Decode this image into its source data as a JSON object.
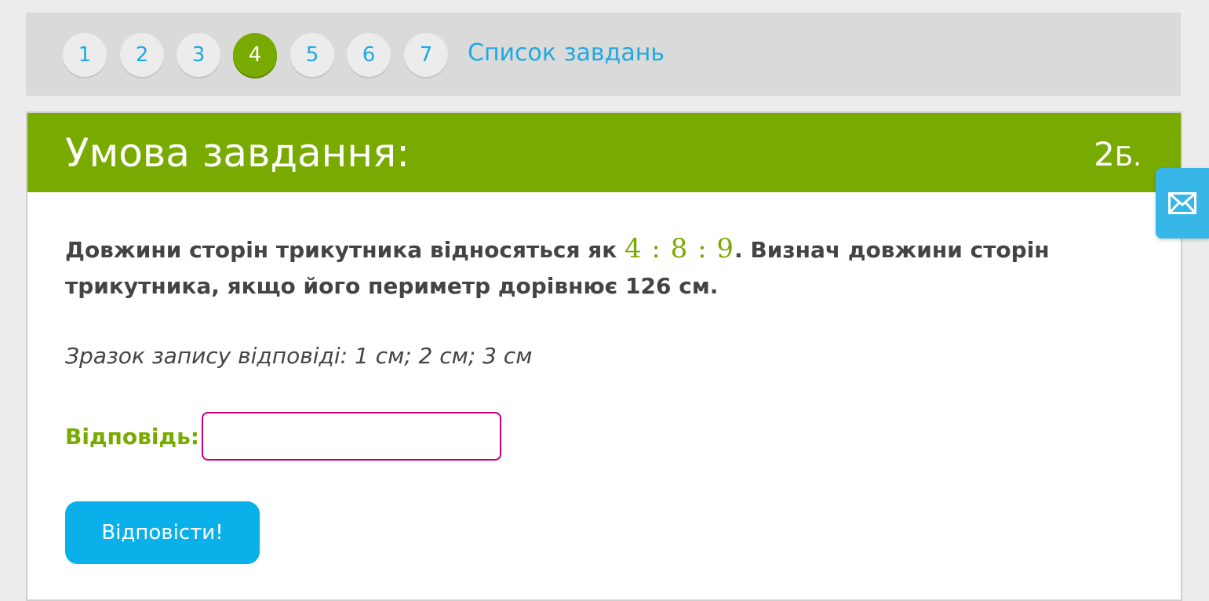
{
  "nav": {
    "tasks": [
      {
        "label": "1",
        "active": false
      },
      {
        "label": "2",
        "active": false
      },
      {
        "label": "3",
        "active": false
      },
      {
        "label": "4",
        "active": true
      },
      {
        "label": "5",
        "active": false
      },
      {
        "label": "6",
        "active": false
      },
      {
        "label": "7",
        "active": false
      }
    ],
    "task_list_label": "Список завдань"
  },
  "panel": {
    "title": "Умова завдання:",
    "score_value": "2",
    "score_unit": "Б."
  },
  "question": {
    "text_before": "Довжини сторін трикутника відносяться як ",
    "ratio": "4 : 8 : 9",
    "text_after": ". Визнач довжини сторін трикутника, якщо його периметр дорівнює 126 см."
  },
  "sample_answer": "Зразок запису відповіді: 1 см; 2 см; 3 см",
  "answer": {
    "label": "Відповідь:",
    "value": ""
  },
  "submit_label": "Відповісти!",
  "colors": {
    "accent_green": "#79aa00",
    "link_blue": "#1ea9e1",
    "button_blue": "#0ab0ea",
    "input_border": "#c0007a",
    "mail_tab": "#37b7e8"
  },
  "icons": {
    "mail_tab": "envelope-icon"
  }
}
